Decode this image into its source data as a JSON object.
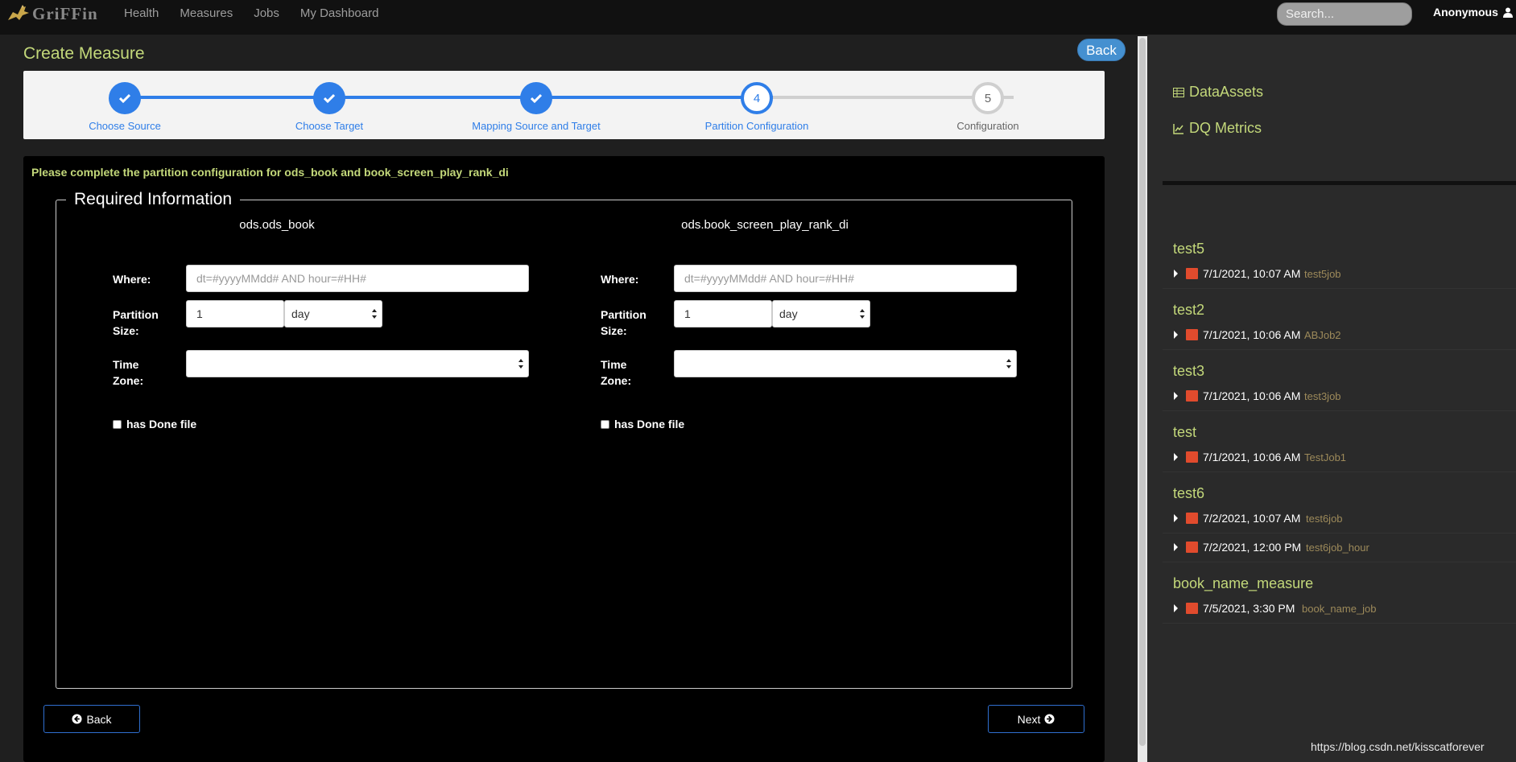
{
  "brand": {
    "name": "GriFFin"
  },
  "nav": {
    "items": [
      "Health",
      "Measures",
      "Jobs",
      "My Dashboard"
    ]
  },
  "search": {
    "placeholder": "Search..."
  },
  "user": {
    "name": "Anonymous"
  },
  "page": {
    "title": "Create Measure",
    "back_label": "Back"
  },
  "steps": [
    {
      "label": "Choose Source",
      "state": "done"
    },
    {
      "label": "Choose Target",
      "state": "done"
    },
    {
      "label": "Mapping Source and Target",
      "state": "done"
    },
    {
      "label": "Partition Configuration",
      "state": "current",
      "number": "4"
    },
    {
      "label": "Configuration",
      "state": "todo",
      "number": "5"
    }
  ],
  "form": {
    "instruction": "Please complete the partition configuration for ods_book and book_screen_play_rank_di",
    "legend": "Required Information",
    "where_label": "Where:",
    "partition_label": "Partition Size:",
    "timezone_label": "Time Zone:",
    "done_file_label": "has Done file",
    "columns": [
      {
        "title": "ods.ods_book",
        "where_placeholder": "dt=#yyyyMMdd# AND hour=#HH#",
        "partition_value": "1",
        "partition_unit": "day",
        "timezone": ""
      },
      {
        "title": "ods.book_screen_play_rank_di",
        "where_placeholder": "dt=#yyyyMMdd# AND hour=#HH#",
        "partition_value": "1",
        "partition_unit": "day",
        "timezone": ""
      }
    ],
    "back_label": "Back",
    "next_label": "Next"
  },
  "sidebar": {
    "links": [
      {
        "label": "DataAssets",
        "icon": "table-icon"
      },
      {
        "label": "DQ Metrics",
        "icon": "line-chart-icon"
      }
    ],
    "metrics": [
      {
        "name": "test5",
        "rows": [
          {
            "time": "7/1/2021, 10:07 AM",
            "job": "test5job"
          }
        ]
      },
      {
        "name": "test2",
        "rows": [
          {
            "time": "7/1/2021, 10:06 AM",
            "job": "ABJob2"
          }
        ]
      },
      {
        "name": "test3",
        "rows": [
          {
            "time": "7/1/2021, 10:06 AM",
            "job": "test3job"
          }
        ]
      },
      {
        "name": "test",
        "rows": [
          {
            "time": "7/1/2021, 10:06 AM",
            "job": "TestJob1"
          }
        ]
      },
      {
        "name": "test6",
        "rows": [
          {
            "time": "7/2/2021, 10:07 AM",
            "job": "test6job"
          },
          {
            "time": "7/2/2021, 12:00 PM",
            "job": "test6job_hour"
          }
        ]
      },
      {
        "name": "book_name_measure",
        "rows": [
          {
            "time": "7/5/2021, 3:30 PM",
            "job": "book_name_job"
          }
        ]
      }
    ]
  },
  "colors": {
    "accent": "#c3d87a",
    "primary": "#2f7ee8",
    "metric_icon": "#e14b2d"
  },
  "watermark": "https://blog.csdn.net/kisscatforever"
}
